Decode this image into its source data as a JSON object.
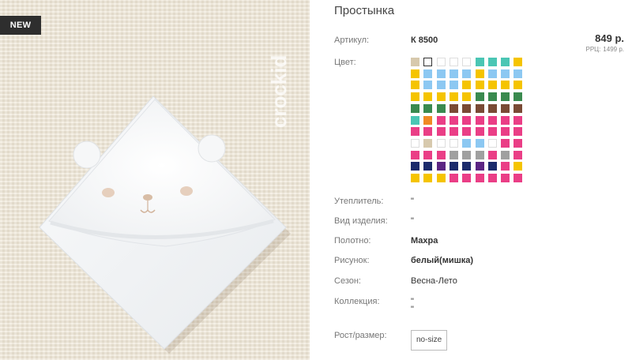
{
  "badge": "NEW",
  "watermark": "crockid",
  "product": {
    "title": "Простынка",
    "price": "849 р.",
    "rrp_label": "РРЦ:",
    "rrp_value": "1499 р."
  },
  "fields": [
    {
      "key": "article",
      "label": "Артикул:",
      "value": "К 8500"
    },
    {
      "key": "color",
      "label": "Цвет:"
    },
    {
      "key": "insulation",
      "label": "Утеплитель:",
      "value": "\""
    },
    {
      "key": "type",
      "label": "Вид изделия:",
      "value": "\""
    },
    {
      "key": "fabric",
      "label": "Полотно:",
      "value": "Махра"
    },
    {
      "key": "pattern",
      "label": "Рисунок:",
      "value": "белый(мишка)"
    },
    {
      "key": "season",
      "label": "Сезон:",
      "value": "Весна-Лето"
    },
    {
      "key": "collection",
      "label": "Коллекция:",
      "value": "\"",
      "value2": "\""
    },
    {
      "key": "size",
      "label": "Рост/размер:",
      "value": "no-size"
    }
  ],
  "colors": {
    "beige": "#d7c9ad",
    "white": "#ffffff",
    "teal": "#4bc6b4",
    "yellow": "#f5c400",
    "lightblue": "#8cc8f2",
    "green": "#3a8a4f",
    "brown": "#7a4a35",
    "orange": "#f08a24",
    "pink": "#ea3e86",
    "gray": "#a0a0a0",
    "navy": "#1b2a6b",
    "purple": "#5b2583"
  },
  "swatch_rows": [
    [
      "beige",
      "white",
      "white",
      "white",
      "white",
      "teal",
      "teal",
      "teal",
      "yellow"
    ],
    [
      "yellow",
      "lightblue",
      "lightblue",
      "lightblue",
      "lightblue",
      "yellow",
      "lightblue",
      "lightblue",
      "lightblue"
    ],
    [
      "yellow",
      "lightblue",
      "lightblue",
      "lightblue",
      "yellow",
      "yellow",
      "yellow",
      "yellow",
      "yellow"
    ],
    [
      "yellow",
      "yellow",
      "yellow",
      "yellow",
      "yellow",
      "green",
      "green",
      "green",
      "green"
    ],
    [
      "green",
      "green",
      "green",
      "brown",
      "brown",
      "brown",
      "brown",
      "brown",
      "brown"
    ],
    [
      "teal",
      "orange",
      "pink",
      "pink",
      "pink",
      "pink",
      "pink",
      "pink",
      "pink"
    ],
    [
      "pink",
      "pink",
      "pink",
      "pink",
      "pink",
      "pink",
      "pink",
      "pink",
      "pink"
    ],
    [
      "white",
      "beige",
      "white",
      "white",
      "lightblue",
      "lightblue",
      "white",
      "pink",
      "pink"
    ],
    [
      "pink",
      "pink",
      "pink",
      "gray",
      "gray",
      "gray",
      "pink",
      "gray",
      "pink"
    ],
    [
      "navy",
      "navy",
      "purple",
      "navy",
      "navy",
      "purple",
      "navy",
      "pink",
      "yellow"
    ],
    [
      "yellow",
      "yellow",
      "yellow",
      "pink",
      "pink",
      "pink",
      "pink",
      "pink",
      "pink"
    ]
  ],
  "selected_swatch": [
    0,
    1
  ]
}
